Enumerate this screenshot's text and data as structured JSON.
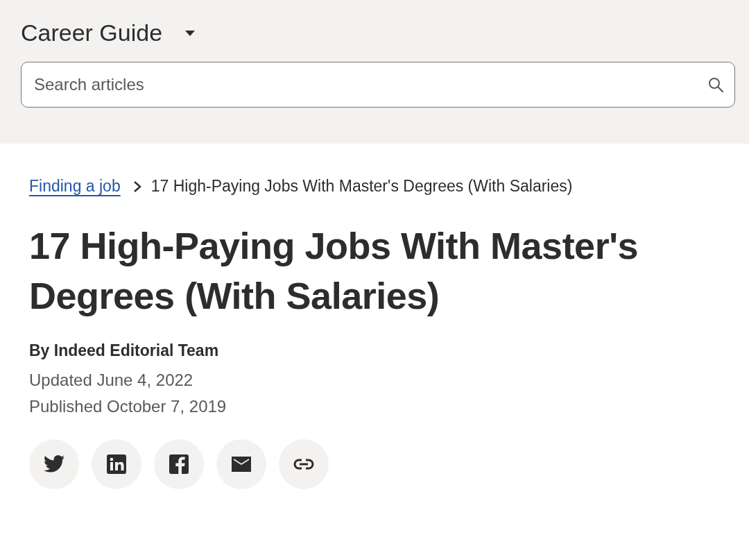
{
  "header": {
    "title": "Career Guide",
    "search": {
      "placeholder": "Search articles"
    }
  },
  "breadcrumb": [
    {
      "label": "Finding a job",
      "kind": "link"
    },
    {
      "label": "17 High-Paying Jobs With Master's Degrees (With Salaries)",
      "kind": "current"
    }
  ],
  "article": {
    "title": "17 High-Paying Jobs With Master's Degrees (With Salaries)",
    "author": "By Indeed Editorial Team",
    "updated": "Updated June 4, 2022",
    "published": "Published October 7, 2019"
  },
  "share": [
    {
      "kind": "twitter"
    },
    {
      "kind": "linkedin"
    },
    {
      "kind": "facebook"
    },
    {
      "kind": "email"
    },
    {
      "kind": "link"
    }
  ]
}
